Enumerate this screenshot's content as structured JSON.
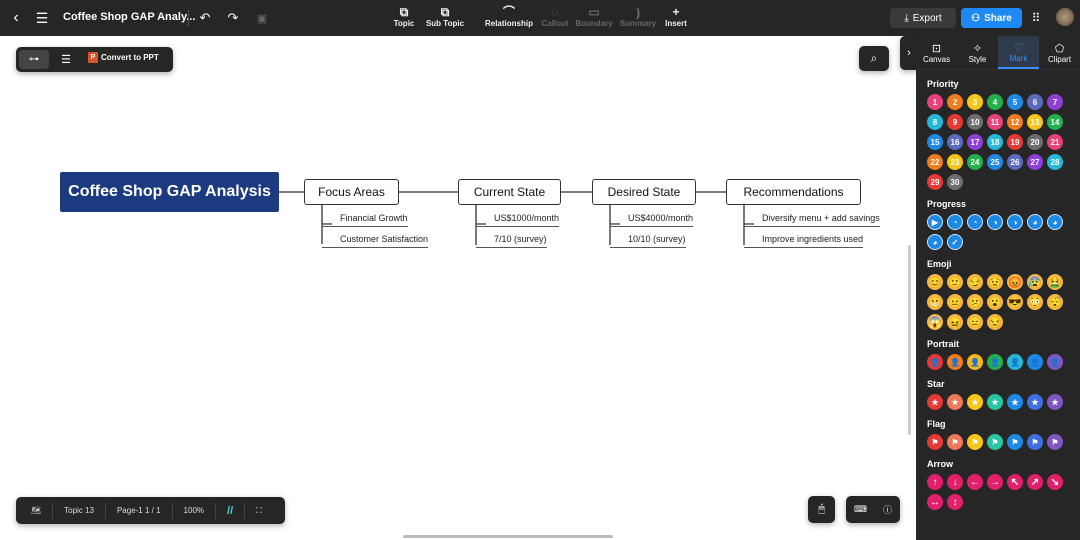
{
  "header": {
    "title": "Coffee Shop GAP Analy...",
    "tools": [
      {
        "label": "Topic",
        "icon": "topic-icon",
        "enabled": true
      },
      {
        "label": "Sub Topic",
        "icon": "subtopic-icon",
        "enabled": true
      },
      {
        "label": "Relationship",
        "icon": "relationship-icon",
        "enabled": true
      },
      {
        "label": "Callout",
        "icon": "callout-icon",
        "enabled": false
      },
      {
        "label": "Boundary",
        "icon": "boundary-icon",
        "enabled": false
      },
      {
        "label": "Summary",
        "icon": "summary-icon",
        "enabled": false
      },
      {
        "label": "Insert",
        "icon": "plus-icon",
        "enabled": true
      }
    ],
    "export": "Export",
    "share": "Share"
  },
  "viewbar": {
    "convert": "Convert to PPT"
  },
  "mindmap": {
    "root": "Coffee Shop GAP Analysis",
    "branches": [
      {
        "label": "Focus Areas",
        "children": [
          "Financial Growth",
          "Customer Satisfaction"
        ]
      },
      {
        "label": "Current State",
        "children": [
          "US$1000/month",
          "7/10 (survey)"
        ]
      },
      {
        "label": "Desired State",
        "children": [
          "US$4000/month",
          "10/10 (survey)"
        ]
      },
      {
        "label": "Recommendations",
        "children": [
          "Diversify menu + add savings",
          "Improve ingredients used"
        ]
      }
    ]
  },
  "statusbar": {
    "topic": "Topic 13",
    "page": "Page-1  1 / 1",
    "zoom": "100%"
  },
  "panel": {
    "tabs": [
      "Canvas",
      "Style",
      "Mark",
      "Clipart"
    ],
    "active": "Mark",
    "sections": {
      "priority": "Priority",
      "progress": "Progress",
      "emoji": "Emoji",
      "portrait": "Portrait",
      "star": "Star",
      "flag": "Flag",
      "arrow": "Arrow"
    },
    "priority_colors": [
      "#e8407a",
      "#f07c1e",
      "#f5c518",
      "#22b14c",
      "#1e88e5",
      "#5c6bc0",
      "#8e3fd8",
      "#26b8d8",
      "#e53935",
      "#6e6e6e"
    ],
    "portrait_colors": [
      "#e53935",
      "#f07c1e",
      "#f5b818",
      "#22b14c",
      "#26b8d8",
      "#1e88e5",
      "#7e57c2"
    ],
    "arrows": [
      "↑",
      "↓",
      "←",
      "→",
      "↖",
      "↗",
      "↘",
      "↔",
      "↕"
    ],
    "progress": [
      "▶",
      "◔",
      "◔",
      "◑",
      "◑",
      "◕",
      "◕",
      "◕",
      "✓"
    ],
    "emoji": [
      "😊",
      "🙂",
      "😏",
      "😟",
      "😡",
      "😰",
      "🤮",
      "😬",
      "😐",
      "😕",
      "😮",
      "😎",
      "😳",
      "😴",
      "😱",
      "😖",
      "😑",
      "😒"
    ]
  }
}
